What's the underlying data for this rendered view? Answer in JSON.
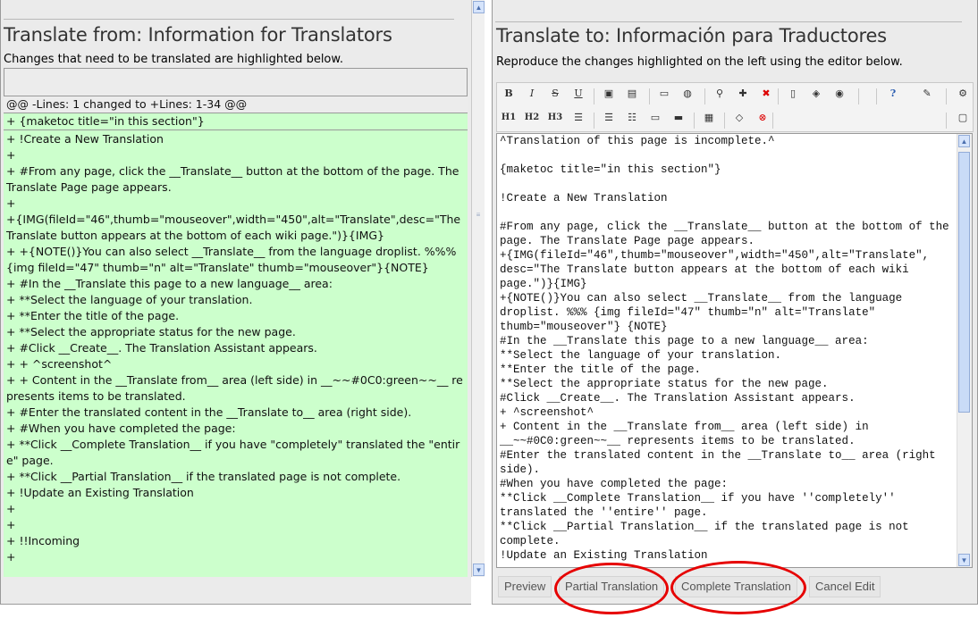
{
  "left": {
    "title": "Translate from: Information for Translators",
    "subtitle": "Changes that need to be translated are highlighted below.",
    "hunk_header": "@@ -Lines: 1 changed to +Lines: 1-34 @@",
    "first_line": "+ {maketoc title=\"in this section\"}",
    "lines": [
      "+ !Create a New Translation",
      "+",
      "+ #From any page, click the __Translate__ button at the bottom of the page. The Translate Page page appears.",
      "+",
      "+{IMG(fileId=\"46\",thumb=\"mouseover\",width=\"450\",alt=\"Translate\",desc=\"The Translate button appears at the bottom of each wiki page.\")}{IMG}",
      "+ +{NOTE()}You can also select __Translate__ from the language droplist. %%% {img fileId=\"47\" thumb=\"n\" alt=\"Translate\" thumb=\"mouseover\"}{NOTE}",
      "+ #In the __Translate this page to a new language__ area:",
      "+ **Select the language of your translation.",
      "+ **Enter the title of the page.",
      "+ **Select the appropriate status for the new page.",
      "+ #Click __Create__. The Translation Assistant appears.",
      "+ + ^screenshot^",
      "+ + Content in the __Translate from__ area (left side) in __~~#0C0:green~~__ represents items to be translated.",
      "+ #Enter the translated content in the __Translate to__ area (right side).",
      "+ #When you have completed the page:",
      "+ **Click __Complete Translation__ if you have \"completely\" translated the \"entire\" page.",
      "+ **Click __Partial Translation__ if the translated page is not complete.",
      "+ !Update an Existing Translation",
      "+",
      "+",
      "+ !!Incoming",
      "+"
    ]
  },
  "right": {
    "title": "Translate to: Información para Traductores",
    "subtitle": "Reproduce the changes highlighted on the left using the editor below.",
    "toolbar_row1": [
      {
        "icon": "bold-icon",
        "glyph": "B"
      },
      {
        "icon": "italic-icon",
        "glyph": "I"
      },
      {
        "icon": "strikethrough-icon",
        "glyph": "S"
      },
      {
        "icon": "underline-icon",
        "glyph": "U"
      },
      {
        "icon": "image-icon",
        "glyph": "▣"
      },
      {
        "icon": "gallery-icon",
        "glyph": "▤"
      },
      {
        "icon": "save-icon",
        "glyph": "▭"
      },
      {
        "icon": "globe-icon",
        "glyph": "◍"
      },
      {
        "icon": "find-icon",
        "glyph": "⚲"
      },
      {
        "icon": "new-page-icon",
        "glyph": "✚"
      },
      {
        "icon": "delete-icon",
        "glyph": "✖"
      },
      {
        "icon": "book-icon",
        "glyph": "▯"
      },
      {
        "icon": "cube-icon",
        "glyph": "◈"
      },
      {
        "icon": "palette-icon",
        "glyph": "◉"
      },
      {
        "icon": "help-icon",
        "glyph": "?"
      },
      {
        "icon": "edit-icon",
        "glyph": "✎"
      },
      {
        "icon": "settings-icon",
        "glyph": "⚙"
      }
    ],
    "toolbar_row2": [
      {
        "icon": "heading1-icon",
        "glyph": "H1"
      },
      {
        "icon": "heading2-icon",
        "glyph": "H2"
      },
      {
        "icon": "heading3-icon",
        "glyph": "H3"
      },
      {
        "icon": "align-center-icon",
        "glyph": "☰"
      },
      {
        "icon": "bullet-list-icon",
        "glyph": "☰"
      },
      {
        "icon": "numbered-list-icon",
        "glyph": "☷"
      },
      {
        "icon": "box-icon",
        "glyph": "▭"
      },
      {
        "icon": "html-icon",
        "glyph": "▬"
      },
      {
        "icon": "table-icon",
        "glyph": "▦"
      },
      {
        "icon": "code-icon",
        "glyph": "◇"
      },
      {
        "icon": "stop-icon",
        "glyph": "⊗"
      },
      {
        "icon": "fullscreen-icon",
        "glyph": "▢"
      }
    ],
    "editor_lines": [
      "^Translation of this page is incomplete.^",
      "",
      "{maketoc title=\"in this section\"}",
      "",
      "!Create a New Translation",
      "",
      "#From any page, click the __Translate__ button at the bottom of the page. The Translate Page page appears.",
      "+{IMG(fileId=\"46\",thumb=\"mouseover\",width=\"450\",alt=\"Translate\", desc=\"The Translate button appears at the bottom of each wiki page.\")}{IMG}",
      "+{NOTE()}You can also select __Translate__ from the language droplist. %%% {img fileId=\"47\" thumb=\"n\" alt=\"Translate\" thumb=\"mouseover\"} {NOTE}",
      "#In the __Translate this page to a new language__ area:",
      "**Select the language of your translation.",
      "**Enter the title of the page.",
      "**Select the appropriate status for the new page.",
      "#Click __Create__. The Translation Assistant appears.",
      "+ ^screenshot^",
      "+ Content in the __Translate from__ area (left side) in __~~#0C0:green~~__ represents items to be translated.",
      "#Enter the translated content in the __Translate to__ area (right side).",
      "#When you have completed the page:",
      "**Click __Complete Translation__ if you have ''completely'' translated the ''entire'' page.",
      "**Click __Partial Translation__ if the translated page is not complete.",
      "!Update an Existing Translation"
    ],
    "buttons": {
      "preview": "Preview",
      "partial": "Partial Translation",
      "complete": "Complete Translation",
      "cancel": "Cancel Edit"
    }
  },
  "colors": {
    "diff_added": "#ccffcc",
    "highlight_circle": "#e60000"
  }
}
